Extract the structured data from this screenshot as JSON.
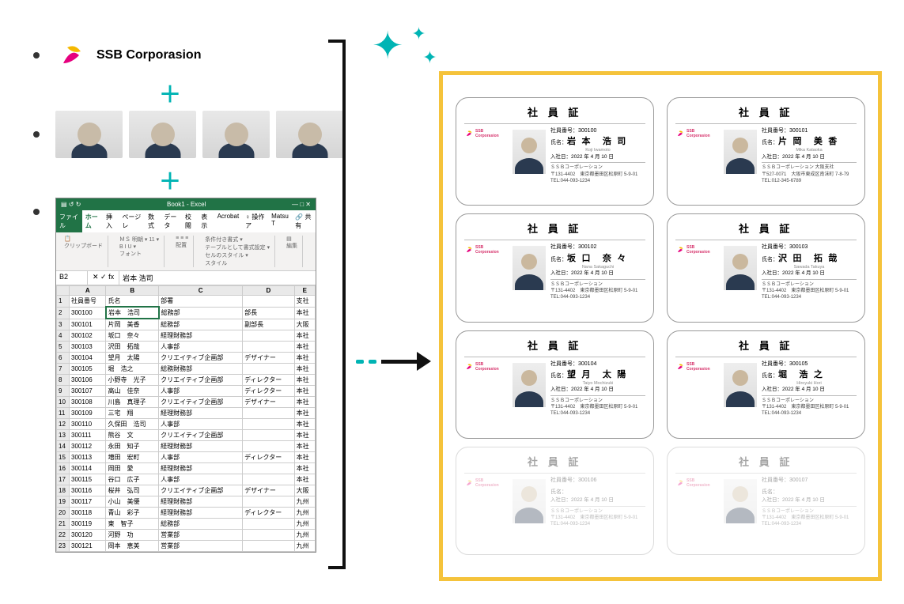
{
  "logo_text": "SSB Corporasion",
  "plus": "＋",
  "excel": {
    "title": "Book1 - Excel",
    "tabs": [
      "ファイル",
      "ホーム",
      "挿入",
      "ページレ",
      "数式",
      "データ",
      "校閲",
      "表示",
      "Acrobat",
      "♀ 操作ア",
      "Matsu T"
    ],
    "cell_ref": "B2",
    "formula": "岩本 浩司",
    "font": "ＭＳ 明朝",
    "share": "共有",
    "ribbon_groups": [
      "クリップボード",
      "フォント",
      "配置",
      "スタイル",
      "編集"
    ],
    "style_items": [
      "条件付き書式",
      "テーブルとして書式設定",
      "セルのスタイル"
    ],
    "cols": [
      "",
      "A",
      "B",
      "C",
      "D",
      "E"
    ],
    "headers": [
      "社員番号",
      "氏名",
      "部署",
      "",
      "支社"
    ],
    "rows": [
      [
        "300100",
        "岩本　浩司",
        "総務部",
        "部長",
        "本社"
      ],
      [
        "300101",
        "片岡　美香",
        "総務部",
        "副部長",
        "大阪"
      ],
      [
        "300102",
        "坂口　奈々",
        "経理財務部",
        "",
        "本社"
      ],
      [
        "300103",
        "沢田　拓哉",
        "人事部",
        "",
        "本社"
      ],
      [
        "300104",
        "望月　太陽",
        "クリエイティブ企画部",
        "デザイナー",
        "本社"
      ],
      [
        "300105",
        "堀　浩之",
        "総務財務部",
        "",
        "本社"
      ],
      [
        "300106",
        "小野寺　光子",
        "クリエイティブ企画部",
        "ディレクター",
        "本社"
      ],
      [
        "300107",
        "高山　佳奈",
        "人事部",
        "ディレクター",
        "本社"
      ],
      [
        "300108",
        "川島　真理子",
        "クリエイティブ企画部",
        "デザイナー",
        "本社"
      ],
      [
        "300109",
        "三宅　翔",
        "経理財務部",
        "",
        "本社"
      ],
      [
        "300110",
        "久保田　浩司",
        "人事部",
        "",
        "本社"
      ],
      [
        "300111",
        "熊谷　文",
        "クリエイティブ企画部",
        "",
        "本社"
      ],
      [
        "300112",
        "永田　知子",
        "経理財務部",
        "",
        "本社"
      ],
      [
        "300113",
        "増田　宏町",
        "人事部",
        "ディレクター",
        "本社"
      ],
      [
        "300114",
        "岡田　愛",
        "経理財務部",
        "",
        "本社"
      ],
      [
        "300115",
        "谷口　広子",
        "人事部",
        "",
        "本社"
      ],
      [
        "300116",
        "桜井　弘司",
        "クリエイティブ企画部",
        "デザイナー",
        "大阪"
      ],
      [
        "300117",
        "小山　美優",
        "経理財務部",
        "",
        "九州"
      ],
      [
        "300118",
        "青山　彩子",
        "経理財務部",
        "ディレクター",
        "九州"
      ],
      [
        "300119",
        "東　智子",
        "総務部",
        "",
        "九州"
      ],
      [
        "300120",
        "河野　功",
        "営業部",
        "",
        "九州"
      ],
      [
        "300121",
        "岡本　恵美",
        "営業部",
        "",
        "九州"
      ]
    ]
  },
  "card_title": "社 員 証",
  "card_logo_text": "SSB Corporasion",
  "id_label": "社員番号：",
  "name_label": "氏名：",
  "join_label": "入社日：",
  "join_date": "2022 年 4 月 10 日",
  "company_main": "ＳＳＢコーポレーション",
  "addr_main": "〒131-4402　東京都墨田区松原町 5-9-01",
  "tel_main": "TEL:044-093-1234",
  "company_osaka": "ＳＳＢコーポレーション 大阪支社",
  "addr_osaka": "〒527-0071　大阪市東成区南沫町 7-8-79",
  "tel_osaka": "TEL:012-345-6789",
  "cards": [
    {
      "id": "300100",
      "name": "岩 本　浩 司",
      "romaji": "Koji Iwamoto",
      "loc": "main"
    },
    {
      "id": "300101",
      "name": "片 岡　美 香",
      "romaji": "Mika Kataoka",
      "loc": "osaka"
    },
    {
      "id": "300102",
      "name": "坂 口　奈 々",
      "romaji": "Nana Sakaguchi",
      "loc": "main"
    },
    {
      "id": "300103",
      "name": "沢 田　拓 哉",
      "romaji": "Sawada Takuya",
      "loc": "main"
    },
    {
      "id": "300104",
      "name": "望 月　太 陽",
      "romaji": "Taiyo Mochizuki",
      "loc": "main"
    },
    {
      "id": "300105",
      "name": "堀　浩 之",
      "romaji": "Hiroyuki Hori",
      "loc": "main"
    }
  ],
  "faded_card_id1": "300106",
  "faded_card_id2": "300107"
}
